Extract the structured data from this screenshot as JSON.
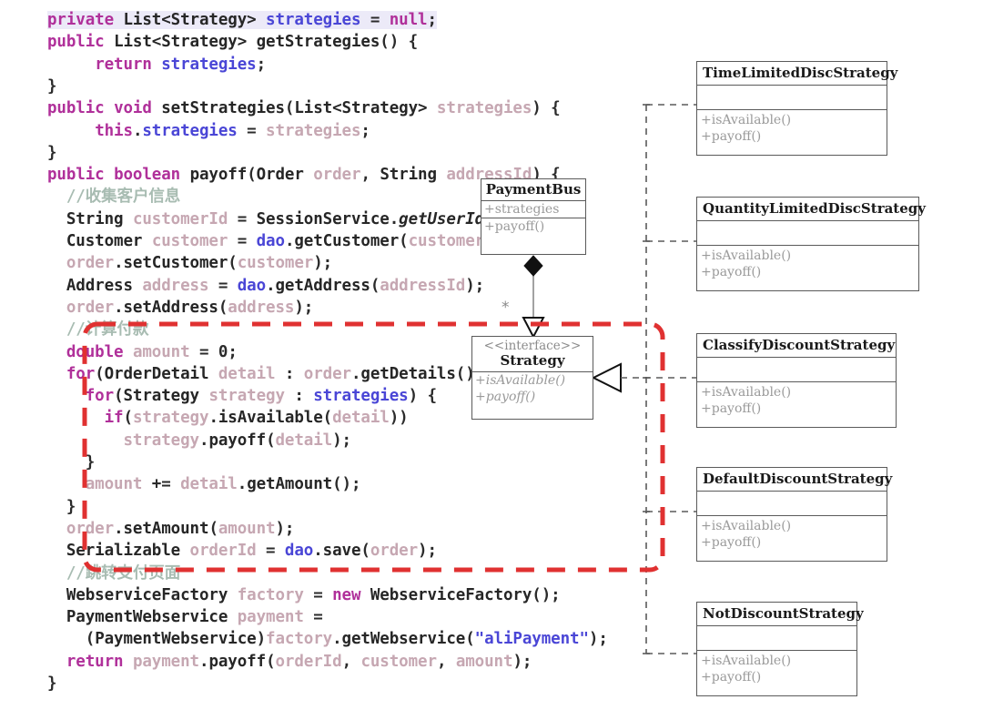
{
  "colors": {
    "keyword": "#b0309a",
    "variable_blue": "#4a46d6",
    "variable_mauve": "#c6a7b2",
    "comment": "#a8bcb2",
    "highlight_box": "#e03131",
    "uml_border": "#5a5a5a",
    "uml_member_text": "#9a9a9a",
    "code_text": "#2b2b2b"
  },
  "code": {
    "lines": [
      {
        "id": "l1",
        "text": "private List<Strategy> strategies = null;"
      },
      {
        "id": "l2",
        "text": "public List<Strategy> getStrategies() {"
      },
      {
        "id": "l3",
        "text": "    return strategies;"
      },
      {
        "id": "l4",
        "text": "}"
      },
      {
        "id": "l5",
        "text": "public void setStrategies(List<Strategy> strategies) {"
      },
      {
        "id": "l6",
        "text": "    this.strategies = strategies;"
      },
      {
        "id": "l7",
        "text": "}"
      },
      {
        "id": "l8",
        "text": "public boolean payoff(Order order, String addressId) {"
      },
      {
        "id": "l9",
        "text": "    //收集客户信息"
      },
      {
        "id": "l10",
        "text": "    String customerId = SessionService.getUserId();"
      },
      {
        "id": "l11",
        "text": "    Customer customer = dao.getCustomer(customerId);"
      },
      {
        "id": "l12",
        "text": "    order.setCustomer(customer);"
      },
      {
        "id": "l13",
        "text": "    Address address = dao.getAddress(addressId);"
      },
      {
        "id": "l14",
        "text": "    order.setAddress(address);"
      },
      {
        "id": "l15",
        "text": "    //计算付款"
      },
      {
        "id": "l16",
        "text": "    double amount = 0;"
      },
      {
        "id": "l17",
        "text": "    for(OrderDetail detail : order.getDetails()) {"
      },
      {
        "id": "l18",
        "text": "      for(Strategy strategy : strategies) {"
      },
      {
        "id": "l19",
        "text": "        if(strategy.isAvailable(detail))"
      },
      {
        "id": "l20",
        "text": "          strategy.payoff(detail);"
      },
      {
        "id": "l21",
        "text": "      }"
      },
      {
        "id": "l22",
        "text": "      amount += detail.getAmount();"
      },
      {
        "id": "l23",
        "text": "    }"
      },
      {
        "id": "l24",
        "text": "    order.setAmount(amount);"
      },
      {
        "id": "l25",
        "text": "    Serializable orderId = dao.save(order);"
      },
      {
        "id": "l26",
        "text": "    //跳转支付页面"
      },
      {
        "id": "l27",
        "text": "    WebserviceFactory factory = new WebserviceFactory();"
      },
      {
        "id": "l28",
        "text": "    PaymentWebservice payment ="
      },
      {
        "id": "l29",
        "text": "      (PaymentWebservice)factory.getWebservice(\"aliPayment\");"
      },
      {
        "id": "l30",
        "text": "    return payment.payoff(orderId, customer, amount);"
      },
      {
        "id": "l31",
        "text": "}"
      }
    ],
    "tokens": {
      "l1": [
        [
          "kw",
          "private"
        ],
        [
          "pn",
          " "
        ],
        [
          "type",
          "List<Strategy>"
        ],
        [
          "pn",
          " "
        ],
        [
          "var2",
          "strategies"
        ],
        [
          "pn",
          " = "
        ],
        [
          "kw",
          "null"
        ],
        [
          "pn",
          ";"
        ]
      ],
      "l2": [
        [
          "kw",
          "public"
        ],
        [
          "pn",
          " "
        ],
        [
          "type",
          "List<Strategy>"
        ],
        [
          "pn",
          " "
        ],
        [
          "mth",
          "getStrategies"
        ],
        [
          "pn",
          "() {"
        ]
      ],
      "l3": [
        [
          "pn",
          "     "
        ],
        [
          "kw",
          "return"
        ],
        [
          "pn",
          " "
        ],
        [
          "var2",
          "strategies"
        ],
        [
          "pn",
          ";"
        ]
      ],
      "l4": [
        [
          "pn",
          "}"
        ]
      ],
      "l5": [
        [
          "kw",
          "public"
        ],
        [
          "pn",
          " "
        ],
        [
          "kw",
          "void"
        ],
        [
          "pn",
          " "
        ],
        [
          "mth",
          "setStrategies"
        ],
        [
          "pn",
          "("
        ],
        [
          "type",
          "List<Strategy>"
        ],
        [
          "pn",
          " "
        ],
        [
          "var",
          "strategies"
        ],
        [
          "pn",
          ") {"
        ]
      ],
      "l6": [
        [
          "pn",
          "     "
        ],
        [
          "kw",
          "this"
        ],
        [
          "pn",
          "."
        ],
        [
          "var2",
          "strategies"
        ],
        [
          "pn",
          " = "
        ],
        [
          "var",
          "strategies"
        ],
        [
          "pn",
          ";"
        ]
      ],
      "l7": [
        [
          "pn",
          "}"
        ]
      ],
      "l8": [
        [
          "kw",
          "public"
        ],
        [
          "pn",
          " "
        ],
        [
          "kw",
          "boolean"
        ],
        [
          "pn",
          " "
        ],
        [
          "mth",
          "payoff"
        ],
        [
          "pn",
          "("
        ],
        [
          "type",
          "Order"
        ],
        [
          "pn",
          " "
        ],
        [
          "var",
          "order"
        ],
        [
          "pn",
          ", "
        ],
        [
          "type",
          "String"
        ],
        [
          "pn",
          " "
        ],
        [
          "var",
          "addressId"
        ],
        [
          "pn",
          ") {"
        ]
      ],
      "l9": [
        [
          "cm",
          "  //收集客户信息"
        ]
      ],
      "l10": [
        [
          "pn",
          "  "
        ],
        [
          "type",
          "String"
        ],
        [
          "pn",
          " "
        ],
        [
          "var",
          "customerId"
        ],
        [
          "pn",
          " = "
        ],
        [
          "type",
          "SessionService"
        ],
        [
          "pn",
          "."
        ],
        [
          "mthi",
          "getUserId"
        ],
        [
          "pn",
          "();"
        ]
      ],
      "l11": [
        [
          "pn",
          "  "
        ],
        [
          "type",
          "Customer"
        ],
        [
          "pn",
          " "
        ],
        [
          "var",
          "customer"
        ],
        [
          "pn",
          " = "
        ],
        [
          "var2",
          "dao"
        ],
        [
          "pn",
          "."
        ],
        [
          "mth",
          "getCustomer"
        ],
        [
          "pn",
          "("
        ],
        [
          "var",
          "customerId"
        ],
        [
          "pn",
          ");"
        ]
      ],
      "l12": [
        [
          "pn",
          "  "
        ],
        [
          "var",
          "order"
        ],
        [
          "pn",
          "."
        ],
        [
          "mth",
          "setCustomer"
        ],
        [
          "pn",
          "("
        ],
        [
          "var",
          "customer"
        ],
        [
          "pn",
          ");"
        ]
      ],
      "l13": [
        [
          "pn",
          "  "
        ],
        [
          "type",
          "Address"
        ],
        [
          "pn",
          " "
        ],
        [
          "var",
          "address"
        ],
        [
          "pn",
          " = "
        ],
        [
          "var2",
          "dao"
        ],
        [
          "pn",
          "."
        ],
        [
          "mth",
          "getAddress"
        ],
        [
          "pn",
          "("
        ],
        [
          "var",
          "addressId"
        ],
        [
          "pn",
          ");"
        ]
      ],
      "l14": [
        [
          "pn",
          "  "
        ],
        [
          "var",
          "order"
        ],
        [
          "pn",
          "."
        ],
        [
          "mth",
          "setAddress"
        ],
        [
          "pn",
          "("
        ],
        [
          "var",
          "address"
        ],
        [
          "pn",
          ");"
        ]
      ],
      "l15": [
        [
          "cm",
          "  //计算付款"
        ]
      ],
      "l16": [
        [
          "pn",
          "  "
        ],
        [
          "kw",
          "double"
        ],
        [
          "pn",
          " "
        ],
        [
          "var",
          "amount"
        ],
        [
          "pn",
          " = "
        ],
        [
          "num",
          "0"
        ],
        [
          "pn",
          ";"
        ]
      ],
      "l17": [
        [
          "pn",
          "  "
        ],
        [
          "kw",
          "for"
        ],
        [
          "pn",
          "("
        ],
        [
          "type",
          "OrderDetail"
        ],
        [
          "pn",
          " "
        ],
        [
          "var",
          "detail"
        ],
        [
          "pn",
          " : "
        ],
        [
          "var",
          "order"
        ],
        [
          "pn",
          "."
        ],
        [
          "mth",
          "getDetails"
        ],
        [
          "pn",
          "()) {"
        ]
      ],
      "l18": [
        [
          "pn",
          "    "
        ],
        [
          "kw",
          "for"
        ],
        [
          "pn",
          "("
        ],
        [
          "type",
          "Strategy"
        ],
        [
          "pn",
          " "
        ],
        [
          "var",
          "strategy"
        ],
        [
          "pn",
          " : "
        ],
        [
          "var2",
          "strategies"
        ],
        [
          "pn",
          ") {"
        ]
      ],
      "l19": [
        [
          "pn",
          "      "
        ],
        [
          "kw",
          "if"
        ],
        [
          "pn",
          "("
        ],
        [
          "var",
          "strategy"
        ],
        [
          "pn",
          "."
        ],
        [
          "mth",
          "isAvailable"
        ],
        [
          "pn",
          "("
        ],
        [
          "var",
          "detail"
        ],
        [
          "pn",
          "))"
        ]
      ],
      "l20": [
        [
          "pn",
          "        "
        ],
        [
          "var",
          "strategy"
        ],
        [
          "pn",
          "."
        ],
        [
          "mth",
          "payoff"
        ],
        [
          "pn",
          "("
        ],
        [
          "var",
          "detail"
        ],
        [
          "pn",
          ");"
        ]
      ],
      "l21": [
        [
          "pn",
          "    }"
        ]
      ],
      "l22": [
        [
          "pn",
          "    "
        ],
        [
          "var",
          "amount"
        ],
        [
          "pn",
          " += "
        ],
        [
          "var",
          "detail"
        ],
        [
          "pn",
          "."
        ],
        [
          "mth",
          "getAmount"
        ],
        [
          "pn",
          "();"
        ]
      ],
      "l23": [
        [
          "pn",
          "  }"
        ]
      ],
      "l24": [
        [
          "pn",
          "  "
        ],
        [
          "var",
          "order"
        ],
        [
          "pn",
          "."
        ],
        [
          "mth",
          "setAmount"
        ],
        [
          "pn",
          "("
        ],
        [
          "var",
          "amount"
        ],
        [
          "pn",
          ");"
        ]
      ],
      "l25": [
        [
          "pn",
          "  "
        ],
        [
          "type",
          "Serializable"
        ],
        [
          "pn",
          " "
        ],
        [
          "var",
          "orderId"
        ],
        [
          "pn",
          " = "
        ],
        [
          "var2",
          "dao"
        ],
        [
          "pn",
          "."
        ],
        [
          "mth",
          "save"
        ],
        [
          "pn",
          "("
        ],
        [
          "var",
          "order"
        ],
        [
          "pn",
          ");"
        ]
      ],
      "l26": [
        [
          "cm",
          "  //跳转支付页面"
        ]
      ],
      "l27": [
        [
          "pn",
          "  "
        ],
        [
          "type",
          "WebserviceFactory"
        ],
        [
          "pn",
          " "
        ],
        [
          "var",
          "factory"
        ],
        [
          "pn",
          " = "
        ],
        [
          "kw",
          "new"
        ],
        [
          "pn",
          " "
        ],
        [
          "mth",
          "WebserviceFactory"
        ],
        [
          "pn",
          "();"
        ]
      ],
      "l28": [
        [
          "pn",
          "  "
        ],
        [
          "type",
          "PaymentWebservice"
        ],
        [
          "pn",
          " "
        ],
        [
          "var",
          "payment"
        ],
        [
          "pn",
          " ="
        ]
      ],
      "l29": [
        [
          "pn",
          "    ("
        ],
        [
          "type",
          "PaymentWebservice"
        ],
        [
          "pn",
          ")"
        ],
        [
          "var",
          "factory"
        ],
        [
          "pn",
          "."
        ],
        [
          "mth",
          "getWebservice"
        ],
        [
          "pn",
          "("
        ],
        [
          "str",
          "\"aliPayment\""
        ],
        [
          "pn",
          ");"
        ]
      ],
      "l30": [
        [
          "pn",
          "  "
        ],
        [
          "kw",
          "return"
        ],
        [
          "pn",
          " "
        ],
        [
          "var",
          "payment"
        ],
        [
          "pn",
          "."
        ],
        [
          "mth",
          "payoff"
        ],
        [
          "pn",
          "("
        ],
        [
          "var",
          "orderId"
        ],
        [
          "pn",
          ", "
        ],
        [
          "var",
          "customer"
        ],
        [
          "pn",
          ", "
        ],
        [
          "var",
          "amount"
        ],
        [
          "pn",
          ");"
        ]
      ],
      "l31": [
        [
          "pn",
          "}"
        ]
      ]
    }
  },
  "uml": {
    "payment_bus": {
      "name": "PaymentBus",
      "attributes": [
        "+strategies"
      ],
      "operations": [
        "+payoff()"
      ]
    },
    "strategy_interface": {
      "stereotype": "<<interface>>",
      "name": "Strategy",
      "operations": [
        "+isAvailable()",
        "+payoff()"
      ]
    },
    "concrete_strategies": [
      {
        "name": "TimeLimitedDiscStrategy",
        "attributes": [],
        "operations": [
          "+isAvailable()",
          "+payoff()"
        ]
      },
      {
        "name": "QuantityLimitedDiscStrategy",
        "attributes": [],
        "operations": [
          "+isAvailable()",
          "+payoff()"
        ]
      },
      {
        "name": "ClassifyDiscountStrategy",
        "attributes": [],
        "operations": [
          "+isAvailable()",
          "+payoff()"
        ]
      },
      {
        "name": "DefaultDiscountStrategy",
        "attributes": [],
        "operations": [
          "+isAvailable()",
          "+payoff()"
        ]
      },
      {
        "name": "NotDiscountStrategy",
        "attributes": [],
        "operations": [
          "+isAvailable()",
          "+payoff()"
        ]
      }
    ],
    "multiplicity_label": "*"
  }
}
